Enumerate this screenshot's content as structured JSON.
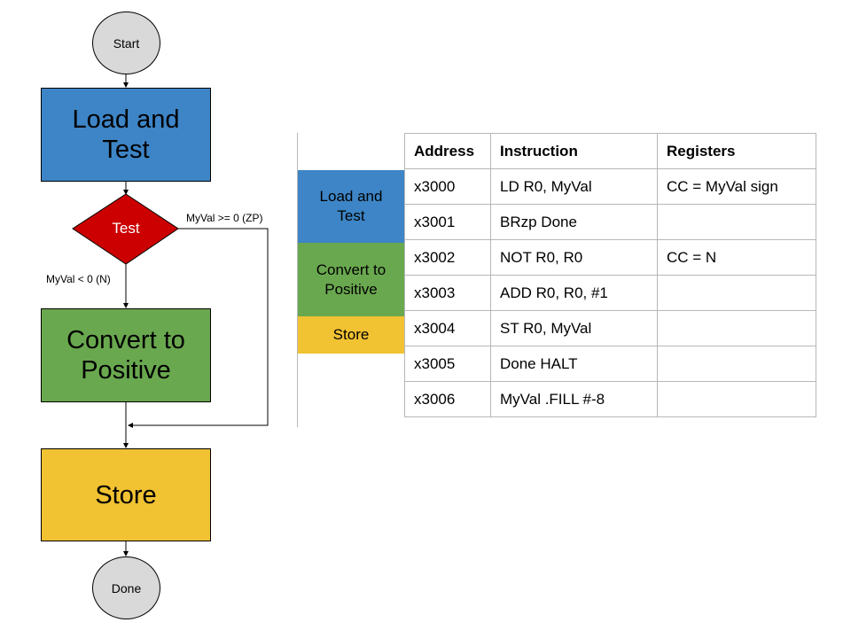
{
  "colors": {
    "load_test": "#3d85c6",
    "decision": "#cc0000",
    "convert": "#6aa84f",
    "store": "#f1c232",
    "terminal": "#d9d9d9",
    "grid": "#b7b7b7"
  },
  "flowchart": {
    "start": "Start",
    "load_test": "Load and Test",
    "decision": "Test",
    "branch_zp": "MyVal >= 0 (ZP)",
    "branch_n": "MyVal < 0 (N)",
    "convert": "Convert to Positive",
    "store": "Store",
    "done": "Done"
  },
  "table": {
    "headers": [
      "Address",
      "Instruction",
      "Registers"
    ],
    "sections": [
      {
        "label": "Load and Test",
        "color": "#3d85c6",
        "rows": 2
      },
      {
        "label": "Convert to Positive",
        "color": "#6aa84f",
        "rows": 2
      },
      {
        "label": "Store",
        "color": "#f1c232",
        "rows": 1
      }
    ],
    "rows": [
      {
        "address": "x3000",
        "instruction": "LD R0, MyVal",
        "registers": "CC = MyVal sign"
      },
      {
        "address": "x3001",
        "instruction": "BRzp Done",
        "registers": ""
      },
      {
        "address": "x3002",
        "instruction": "NOT R0, R0",
        "registers": "CC = N"
      },
      {
        "address": "x3003",
        "instruction": "ADD R0, R0, #1",
        "registers": ""
      },
      {
        "address": "x3004",
        "instruction": "ST R0, MyVal",
        "registers": ""
      },
      {
        "address": "x3005",
        "instruction": "Done HALT",
        "registers": ""
      },
      {
        "address": "x3006",
        "instruction": "MyVal .FILL #-8",
        "registers": ""
      }
    ]
  }
}
